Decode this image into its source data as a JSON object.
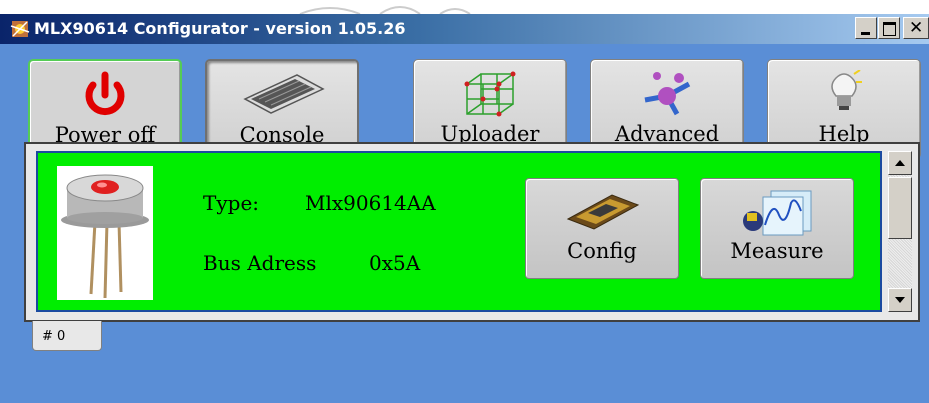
{
  "window": {
    "title": "MLX90614 Configurator  -  version 1.05.26"
  },
  "toolbar": {
    "buttons": [
      {
        "label": "Power off",
        "icon": "power-icon",
        "state": "active"
      },
      {
        "label": "Console",
        "icon": "keyboard-icon",
        "state": "pressed"
      },
      {
        "label": "Uploader",
        "icon": "cube-grid-icon",
        "state": "normal"
      },
      {
        "label": "Advanced",
        "icon": "molecule-icon",
        "state": "normal"
      },
      {
        "label": "Help",
        "icon": "lightbulb-icon",
        "state": "normal"
      }
    ]
  },
  "device": {
    "type_label": "Type:",
    "type_value": "Mlx90614AA",
    "bus_label": "Bus Adress",
    "bus_value": "0x5A",
    "image_icon": "sensor-image",
    "buttons": [
      {
        "label": "Config",
        "icon": "chip-icon"
      },
      {
        "label": "Measure",
        "icon": "chart-icon"
      }
    ]
  },
  "tabs": [
    {
      "label": "# 0"
    }
  ],
  "colors": {
    "panel": "#00ee00",
    "client": "#5a8ed6",
    "active_border": "#55cc55"
  }
}
